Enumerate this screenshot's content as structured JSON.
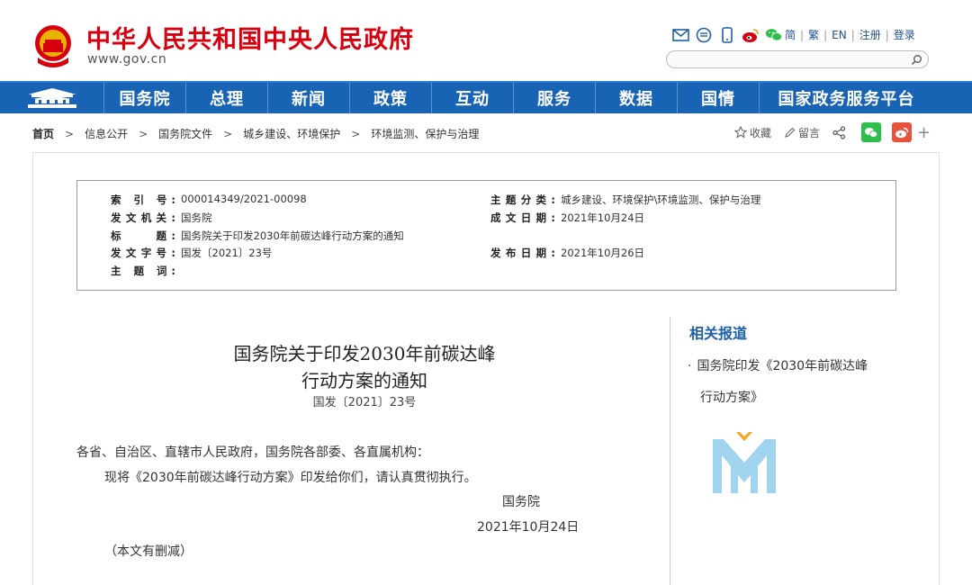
{
  "header": {
    "site_title": "中华人民共和国中央人民政府",
    "site_url": "www.gov.cn",
    "lang_links": [
      "简",
      "繁",
      "EN",
      "注册",
      "登录"
    ],
    "icons": [
      "mail-icon",
      "message-icon",
      "mobile-icon",
      "weibo-icon",
      "wechat-icon"
    ]
  },
  "nav": {
    "items": [
      "国务院",
      "总理",
      "新闻",
      "政策",
      "互动",
      "服务",
      "数据",
      "国情"
    ],
    "platform": "国家政务服务平台"
  },
  "breadcrumb": [
    "首页",
    "信息公开",
    "国务院文件",
    "城乡建设、环境保护",
    "环境监测、保护与治理"
  ],
  "tools": {
    "favorite": "收藏",
    "comment": "留言",
    "plus": "+"
  },
  "meta": {
    "index_label": "索 引 号:",
    "index_value": "000014349/2021-00098",
    "issuer_label": "发文机关:",
    "issuer_value": "国务院",
    "title_label": "标　　题:",
    "title_value": "国务院关于印发2030年前碳达峰行动方案的通知",
    "docno_label": "发文字号:",
    "docno_value": "国发〔2021〕23号",
    "keywords_label": "主 题 词:",
    "keywords_value": "",
    "topic_label": "主题分类:",
    "topic_value": "城乡建设、环境保护\\环境监测、保护与治理",
    "written_label": "成文日期:",
    "written_value": "2021年10月24日",
    "published_label": "发布日期:",
    "published_value": "2021年10月26日"
  },
  "article": {
    "title_line1": "国务院关于印发2030年前碳达峰",
    "title_line2": "行动方案的通知",
    "number": "国发〔2021〕23号",
    "salutation": "各省、自治区、直辖市人民政府，国务院各部委、各直属机构：",
    "body": "现将《2030年前碳达峰行动方案》印发给你们，请认真贯彻执行。",
    "signer": "国务院",
    "date": "2021年10月24日",
    "note": "（本文有删减）"
  },
  "sidebar": {
    "related_title": "相关报道",
    "related_line1": "国务院印发《2030年前碳达峰",
    "related_line2": "行动方案》"
  },
  "colors": {
    "brand_red": "#d7000f",
    "nav_blue": "#1963b4",
    "link_blue": "#1f5fa6",
    "watermark_blue": "#9fd3ee",
    "watermark_orange": "#f5a623"
  }
}
